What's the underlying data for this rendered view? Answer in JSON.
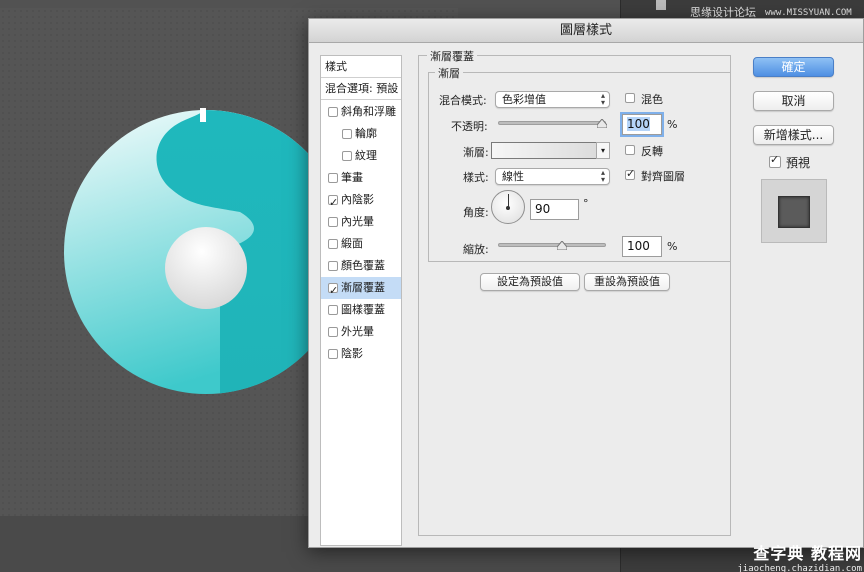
{
  "background_app": {
    "top_text": "思缘设计论坛",
    "top_url": "www.MISSYUAN.COM",
    "watermark_main": "查字典 教程网",
    "watermark_url": "jiaocheng.chazidian.com"
  },
  "logo": {
    "gradient_top": "#f2fbfb",
    "gradient_bottom": "#4ccfcf",
    "teal_accent": "#22b8bc"
  },
  "dialog": {
    "title": "圖層樣式",
    "styles_list": {
      "header": "樣式",
      "blending_options": "混合選項: 預設",
      "items": [
        {
          "label": "斜角和浮雕",
          "checked": false,
          "indent": false,
          "selected": false
        },
        {
          "label": "輪廓",
          "checked": false,
          "indent": true,
          "selected": false
        },
        {
          "label": "紋理",
          "checked": false,
          "indent": true,
          "selected": false
        },
        {
          "label": "筆畫",
          "checked": false,
          "indent": false,
          "selected": false
        },
        {
          "label": "內陰影",
          "checked": true,
          "indent": false,
          "selected": false
        },
        {
          "label": "內光暈",
          "checked": false,
          "indent": false,
          "selected": false
        },
        {
          "label": "緞面",
          "checked": false,
          "indent": false,
          "selected": false
        },
        {
          "label": "顏色覆蓋",
          "checked": false,
          "indent": false,
          "selected": false
        },
        {
          "label": "漸層覆蓋",
          "checked": true,
          "indent": false,
          "selected": true
        },
        {
          "label": "圖樣覆蓋",
          "checked": false,
          "indent": false,
          "selected": false
        },
        {
          "label": "外光暈",
          "checked": false,
          "indent": false,
          "selected": false
        },
        {
          "label": "陰影",
          "checked": false,
          "indent": false,
          "selected": false
        }
      ]
    },
    "gradient_overlay": {
      "section_title": "漸層覆蓋",
      "subsection_title": "漸層",
      "blend_mode_label": "混合模式:",
      "blend_mode_value": "色彩增值",
      "dither_label": "混色",
      "dither_checked": false,
      "opacity_label": "不透明:",
      "opacity_value": "100",
      "opacity_percent": 100,
      "percent_sign": "%",
      "gradient_label": "漸層:",
      "reverse_label": "反轉",
      "reverse_checked": false,
      "style_label": "樣式:",
      "style_value": "線性",
      "align_label": "對齊圖層",
      "align_checked": true,
      "angle_label": "角度:",
      "angle_value": "90",
      "degree_sign": "°",
      "scale_label": "縮放:",
      "scale_value": "100",
      "scale_percent": 100,
      "make_default_button": "設定為預設值",
      "reset_default_button": "重設為預設值"
    },
    "buttons": {
      "ok": "確定",
      "cancel": "取消",
      "new_style": "新增樣式...",
      "preview_label": "預視",
      "preview_checked": true
    }
  }
}
